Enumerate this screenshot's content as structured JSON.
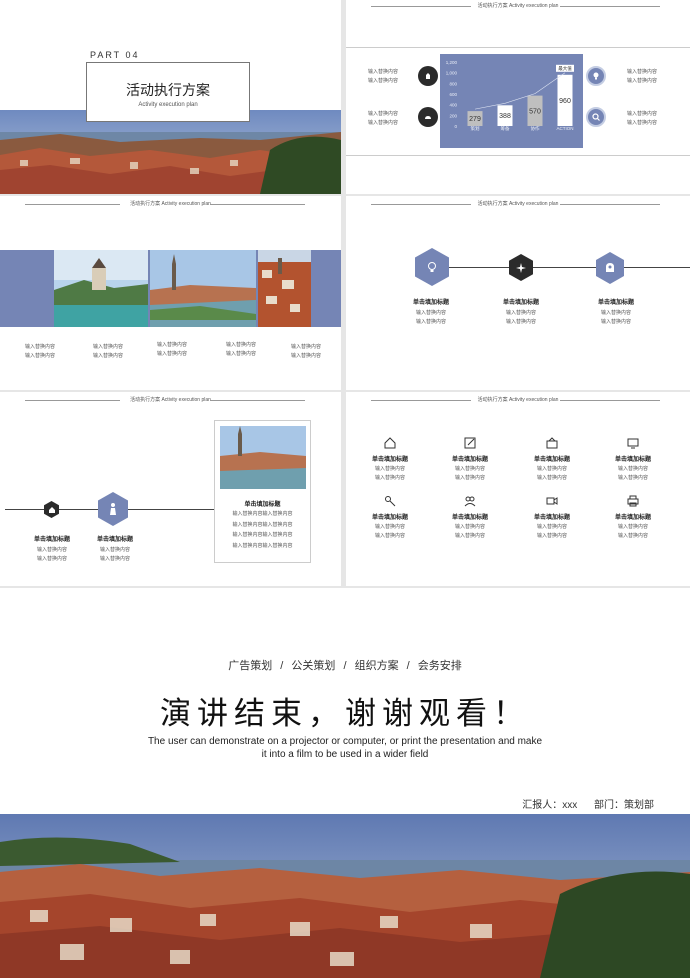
{
  "slide1": {
    "part": "PART 04",
    "title": "活动执行方案",
    "subtitle": "Activity execution plan"
  },
  "slide2": {
    "header": "活动执行方案 Activity execution plan",
    "left_items": [
      {
        "l1": "输入替换内容",
        "l2": "输入替换内容"
      },
      {
        "l1": "输入替换内容",
        "l2": "输入替换内容"
      }
    ],
    "right_items": [
      {
        "l1": "输入替换内容",
        "l2": "输入替换内容"
      },
      {
        "l1": "输入替换内容",
        "l2": "输入替换内容"
      }
    ],
    "chart_data": {
      "type": "bar",
      "categories": [
        "策划",
        "筹备",
        "协作",
        "ACTION"
      ],
      "values": [
        279,
        388,
        570,
        960
      ],
      "ylim": [
        0,
        1200
      ],
      "yticks": [
        "0",
        "200",
        "400",
        "600",
        "800",
        "1,000",
        "1,200"
      ],
      "tag": "最大值",
      "colors": {
        "bg": "#7585b5",
        "bar": "#ffffff",
        "bar_mid": "#bfbfbf"
      }
    }
  },
  "slide3": {
    "header": "活动执行方案 Activity execution plan",
    "cols": [
      {
        "l1": "输入替换内容",
        "l2": "输入替换内容"
      },
      {
        "l1": "输入替换内容",
        "l2": "输入替换内容"
      },
      {
        "l1": "输入替换内容",
        "l2": "输入替换内容"
      },
      {
        "l1": "输入替换内容",
        "l2": "输入替换内容"
      },
      {
        "l1": "输入替换内容",
        "l2": "输入替换内容"
      }
    ]
  },
  "slide4": {
    "header": "活动执行方案 Activity execution plan",
    "items": [
      {
        "title": "单击填加标题",
        "l1": "输入替换内容",
        "l2": "输入替换内容"
      },
      {
        "title": "单击填加标题",
        "l1": "输入替换内容",
        "l2": "输入替换内容"
      },
      {
        "title": "单击填加标题",
        "l1": "输入替换内容",
        "l2": "输入替换内容"
      }
    ]
  },
  "slide5": {
    "header": "活动执行方案 Activity execution plan",
    "items": [
      {
        "title": "单击填加标题",
        "l1": "输入替换内容",
        "l2": "输入替换内容"
      },
      {
        "title": "单击填加标题",
        "l1": "输入替换内容",
        "l2": "输入替换内容"
      }
    ],
    "card": {
      "title": "单击填加标题",
      "lines": [
        "输入替换内容输入替换内容",
        "输入替换内容输入替换内容",
        "输入替换内容输入替换内容",
        "输入替换内容输入替换内容"
      ]
    }
  },
  "slide6": {
    "header": "活动执行方案 Activity execution plan",
    "items": [
      {
        "icon": "home-icon",
        "title": "单击填加标题",
        "l1": "输入替换内容",
        "l2": "输入替换内容"
      },
      {
        "icon": "edit-icon",
        "title": "单击填加标题",
        "l1": "输入替换内容",
        "l2": "输入替换内容"
      },
      {
        "icon": "cart-icon",
        "title": "单击填加标题",
        "l1": "输入替换内容",
        "l2": "输入替换内容"
      },
      {
        "icon": "monitor-icon",
        "title": "单击填加标题",
        "l1": "输入替换内容",
        "l2": "输入替换内容"
      },
      {
        "icon": "tools-icon",
        "title": "单击填加标题",
        "l1": "输入替换内容",
        "l2": "输入替换内容"
      },
      {
        "icon": "users-icon",
        "title": "单击填加标题",
        "l1": "输入替换内容",
        "l2": "输入替换内容"
      },
      {
        "icon": "video-icon",
        "title": "单击填加标题",
        "l1": "输入替换内容",
        "l2": "输入替换内容"
      },
      {
        "icon": "printer-icon",
        "title": "单击填加标题",
        "l1": "输入替换内容",
        "l2": "输入替换内容"
      }
    ]
  },
  "final": {
    "tags": [
      "广告策划",
      "公关策划",
      "组织方案",
      "会务安排"
    ],
    "sep": "/",
    "title": "演讲结束，谢谢观看！",
    "desc1": "The user can demonstrate on a projector or computer, or print the presentation and make",
    "desc2": "it into a film to be used in a wider field",
    "reporter": "汇报人：xxx",
    "dept": "部门：策划部"
  },
  "colors": {
    "accent": "#7585b5",
    "dark": "#2b2b2b"
  }
}
